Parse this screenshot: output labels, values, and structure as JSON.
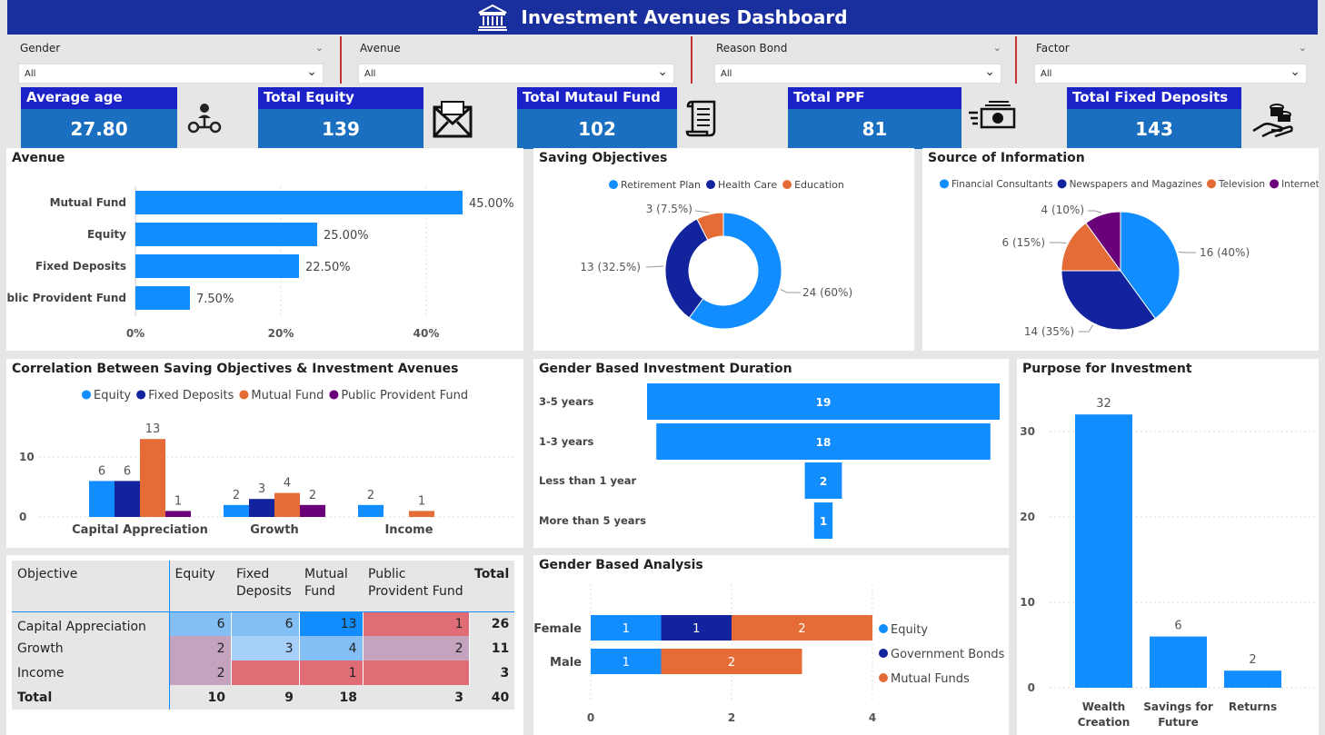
{
  "header": {
    "title": "Investment Avenues Dashboard"
  },
  "filters": [
    {
      "label": "Gender",
      "value": "All"
    },
    {
      "label": "Avenue",
      "value": "All"
    },
    {
      "label": "Reason Bond",
      "value": "All"
    },
    {
      "label": "Factor",
      "value": "All"
    }
  ],
  "kpis": [
    {
      "label": "Average age",
      "value": "27.80",
      "icon": "people-network-icon"
    },
    {
      "label": "Total Equity",
      "value": "139",
      "icon": "envelope-icon"
    },
    {
      "label": "Total Mutaul Fund",
      "value": "102",
      "icon": "scroll-icon"
    },
    {
      "label": "Total PPF",
      "value": "81",
      "icon": "cash-icon"
    },
    {
      "label": "Total Fixed Deposits",
      "value": "143",
      "icon": "coins-hand-icon"
    }
  ],
  "colors": {
    "blue": "#118dff",
    "navy": "#12239e",
    "orange": "#e66c37",
    "purple": "#6b007b",
    "header": "#1a2f9e"
  },
  "chart_data": [
    {
      "id": "avenue",
      "type": "bar",
      "orientation": "horizontal",
      "title": "Avenue",
      "categories": [
        "Mutual Fund",
        "Equity",
        "Fixed Deposits",
        "Public Provident Fund"
      ],
      "values": [
        45.0,
        25.0,
        22.5,
        7.5
      ],
      "data_labels": [
        "45.00%",
        "25.00%",
        "22.50%",
        "7.50%"
      ],
      "xticks": [
        "0%",
        "20%",
        "40%"
      ],
      "xlim": [
        0,
        50
      ]
    },
    {
      "id": "saving_objectives",
      "type": "pie",
      "donut": true,
      "title": "Saving Objectives",
      "legend": [
        "Retirement Plan",
        "Health Care",
        "Education"
      ],
      "values": [
        24,
        13,
        3
      ],
      "labels": [
        "24 (60%)",
        "13 (32.5%)",
        "3 (7.5%)"
      ],
      "colors": [
        "#118dff",
        "#12239e",
        "#e66c37"
      ]
    },
    {
      "id": "source_of_information",
      "type": "pie",
      "title": "Source of Information",
      "legend": [
        "Financial Consultants",
        "Newspapers and Magazines",
        "Television",
        "Internet"
      ],
      "values": [
        16,
        14,
        6,
        4
      ],
      "labels": [
        "16 (40%)",
        "14 (35%)",
        "6 (15%)",
        "4 (10%)"
      ],
      "colors": [
        "#118dff",
        "#12239e",
        "#e66c37",
        "#6b007b"
      ]
    },
    {
      "id": "correlation",
      "type": "bar",
      "title": "Correlation Between Saving Objectives & Investment Avenues",
      "categories": [
        "Capital Appreciation",
        "Growth",
        "Income"
      ],
      "series": [
        {
          "name": "Equity",
          "values": [
            6,
            2,
            2
          ],
          "color": "#118dff"
        },
        {
          "name": "Fixed Deposits",
          "values": [
            6,
            3,
            null
          ],
          "color": "#12239e"
        },
        {
          "name": "Mutual Fund",
          "values": [
            13,
            4,
            1
          ],
          "color": "#e66c37"
        },
        {
          "name": "Public Provident Fund",
          "values": [
            1,
            2,
            null
          ],
          "color": "#6b007b"
        }
      ],
      "yticks": [
        "0",
        "10"
      ],
      "ylim": [
        0,
        15
      ]
    },
    {
      "id": "duration",
      "type": "bar",
      "subtype": "funnel",
      "title": "Gender Based Investment Duration",
      "categories": [
        "3-5 years",
        "1-3 years",
        "Less than 1 year",
        "More than 5 years"
      ],
      "values": [
        19,
        18,
        2,
        1
      ]
    },
    {
      "id": "gender_analysis",
      "type": "bar",
      "orientation": "horizontal",
      "stacked": true,
      "title": "Gender Based Analysis",
      "categories": [
        "Female",
        "Male"
      ],
      "series": [
        {
          "name": "Equity",
          "values": [
            1,
            1
          ],
          "color": "#118dff"
        },
        {
          "name": "Government Bonds",
          "values": [
            1,
            null
          ],
          "color": "#12239e"
        },
        {
          "name": "Mutual Funds",
          "values": [
            2,
            2
          ],
          "color": "#e66c37"
        }
      ],
      "xticks": [
        "0",
        "2",
        "4"
      ],
      "xlim": [
        0,
        4
      ]
    },
    {
      "id": "purpose",
      "type": "bar",
      "title": "Purpose for Investment",
      "categories": [
        "Wealth Creation",
        "Savings for Future",
        "Returns"
      ],
      "category_lines": [
        [
          "Wealth",
          "Creation"
        ],
        [
          "Savings for",
          "Future"
        ],
        [
          "Returns"
        ]
      ],
      "values": [
        32,
        6,
        2
      ],
      "yticks": [
        "0",
        "10",
        "20",
        "30"
      ],
      "ylim": [
        0,
        34
      ]
    }
  ],
  "matrix": {
    "headers": [
      [
        "Objective"
      ],
      [
        "Equity"
      ],
      [
        "Fixed",
        "Deposits"
      ],
      [
        "Mutual",
        "Fund"
      ],
      [
        "Public",
        "Provident Fund"
      ],
      [
        "Total"
      ]
    ],
    "rows": [
      {
        "label": "Capital Appreciation",
        "cells": [
          "6",
          "6",
          "13",
          "1"
        ],
        "total": "26"
      },
      {
        "label": "Growth",
        "cells": [
          "2",
          "3",
          "4",
          "2"
        ],
        "total": "11"
      },
      {
        "label": "Income",
        "cells": [
          "2",
          "",
          "1",
          ""
        ],
        "total": "3"
      }
    ],
    "cell_colors": [
      [
        "#83bff5",
        "#83bff5",
        "#118dff",
        "#e06c75"
      ],
      [
        "#c4a3be",
        "#a6cffa",
        "#83bff5",
        "#c4a3be"
      ],
      [
        "#c4a3be",
        "#e06c75",
        "#e06c75",
        "#e06c75"
      ]
    ],
    "total_row": {
      "label": "Total",
      "cells": [
        "10",
        "9",
        "18",
        "3"
      ],
      "total": "40"
    }
  }
}
